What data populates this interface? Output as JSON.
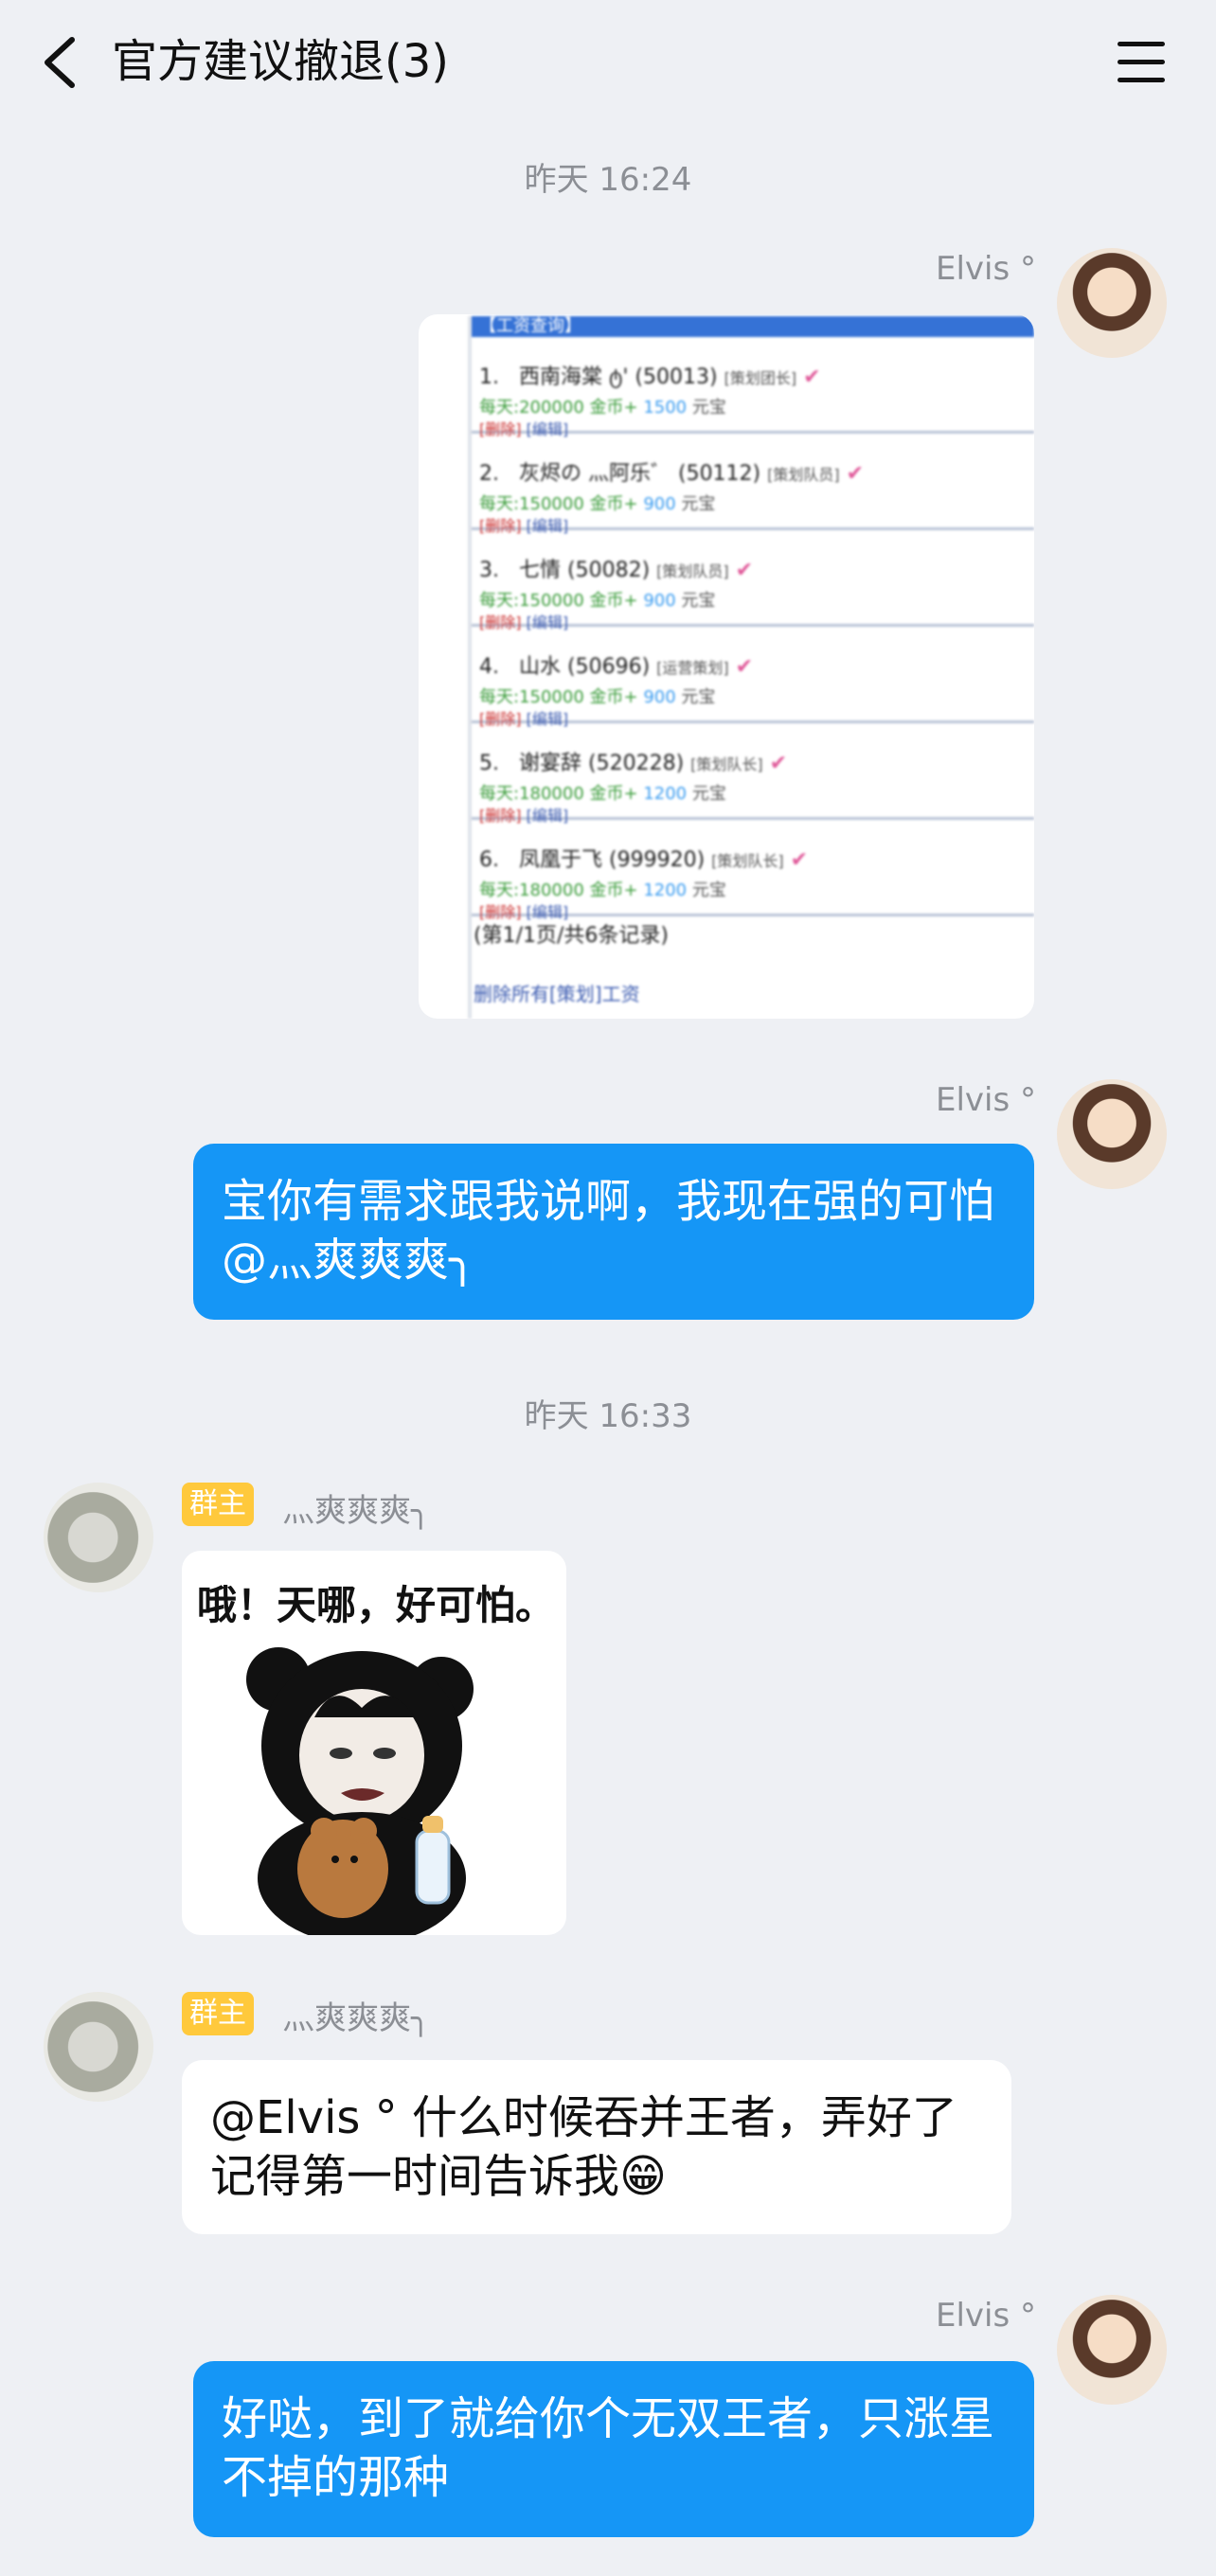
{
  "header": {
    "title": "官方建议撤退(3)"
  },
  "messages": {
    "ts1": "昨天 16:24",
    "elvis_name": "Elvis °",
    "card": {
      "head": "【工资查询】",
      "rows": [
        {
          "no": "1.",
          "name": "西南海棠 ტ'",
          "id": "(50013)",
          "role": "[策划团长]",
          "daily": "每天:200000 金币+",
          "gems": "1500",
          "unit": "元宝",
          "del": "[删除]",
          "edit": "[编辑]"
        },
        {
          "no": "2.",
          "name": "灰烬の 灬阿乐゛",
          "id": "(50112)",
          "role": "[策划队员]",
          "daily": "每天:150000 金币+",
          "gems": "900",
          "unit": "元宝",
          "del": "[删除]",
          "edit": "[编辑]"
        },
        {
          "no": "3.",
          "name": "七情",
          "id": "(50082)",
          "role": "[策划队员]",
          "daily": "每天:150000 金币+",
          "gems": "900",
          "unit": "元宝",
          "del": "[删除]",
          "edit": "[编辑]"
        },
        {
          "no": "4.",
          "name": "山水",
          "id": "(50696)",
          "role": "[运营策划]",
          "daily": "每天:150000 金币+",
          "gems": "900",
          "unit": "元宝",
          "del": "[删除]",
          "edit": "[编辑]"
        },
        {
          "no": "5.",
          "name": "谢宴辞",
          "id": "(520228)",
          "role": "[策划队长]",
          "daily": "每天:180000 金币+",
          "gems": "1200",
          "unit": "元宝",
          "del": "[删除]",
          "edit": "[编辑]"
        },
        {
          "no": "6.",
          "name": "凤凰于飞",
          "id": "(999920)",
          "role": "[策划队长]",
          "daily": "每天:180000 金币+",
          "gems": "1200",
          "unit": "元宝",
          "del": "[删除]",
          "edit": "[编辑]"
        }
      ],
      "foot1": "(第1/1页/共6条记录)",
      "foot2": "删除所有[策划]工资"
    },
    "msg2": "宝你有需求跟我说啊，我现在强的可怕@灬爽爽爽╮",
    "ts2": "昨天 16:33",
    "owner_badge": "群主",
    "shuang_name": "灬爽爽爽╮",
    "sticker_caption": "哦！天哪，好可怕。",
    "msg3": "@Elvis ° 什么时候吞并王者，弄好了记得第一时间告诉我",
    "msg3_emoji": "😁",
    "msg4": "好哒，到了就给你个无双王者，只涨星不掉的那种"
  }
}
